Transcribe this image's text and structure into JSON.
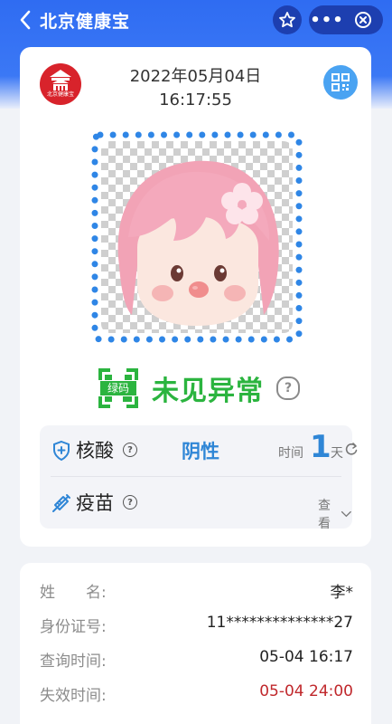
{
  "nav": {
    "title": "北京健康宝",
    "more_label": "•••"
  },
  "header": {
    "logo_text": "北京健康宝",
    "date": "2022年05月04日",
    "time": "16:17:55"
  },
  "status": {
    "code_label": "绿码",
    "text": "未见异常",
    "color": "#2bb43f"
  },
  "nucleic": {
    "label": "核酸",
    "result": "阴性",
    "time_label": "时间",
    "days": "1",
    "unit": "天"
  },
  "vaccine": {
    "label": "疫苗",
    "view_label": "查看"
  },
  "personal": {
    "rows": [
      {
        "key": "姓　　名:",
        "value": "李*"
      },
      {
        "key": "身份证号:",
        "value": "11**************27"
      },
      {
        "key": "查询时间:",
        "value": "05-04 16:17"
      },
      {
        "key": "失效时间:",
        "value": "05-04 24:00"
      }
    ]
  },
  "colors": {
    "brand_blue": "#2f6cf2",
    "green": "#2bb43f",
    "expiry_red": "#c0282c",
    "accent_blue": "#2f86d6"
  }
}
